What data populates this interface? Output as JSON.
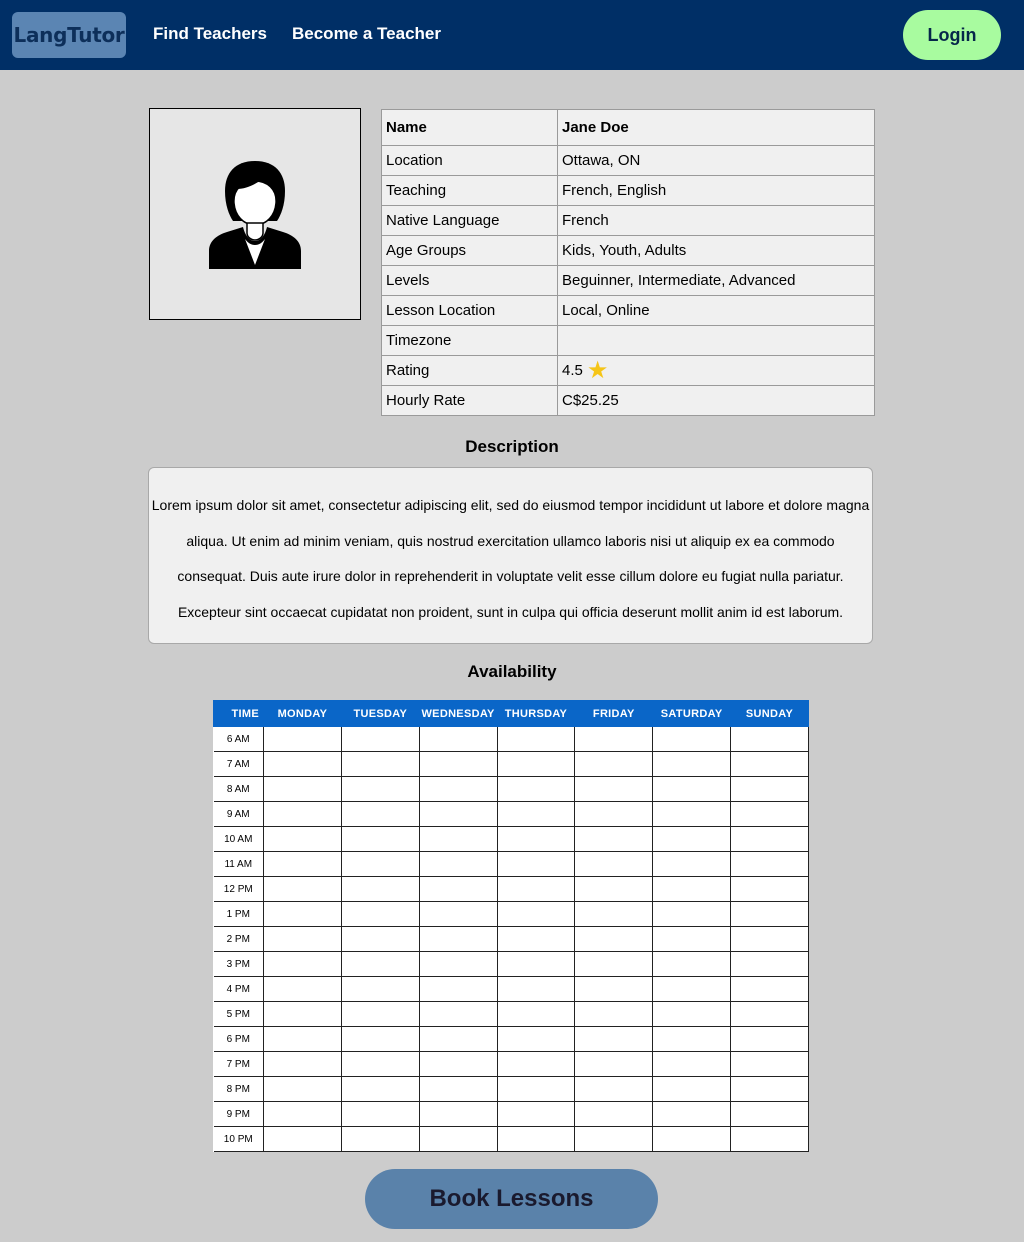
{
  "nav": {
    "logo": "LangTutor",
    "links": [
      "Find Teachers",
      "Become a Teacher"
    ],
    "login": "Login"
  },
  "profile": {
    "photo_icon": "person-avatar-icon",
    "rows": [
      {
        "label": "Name",
        "value": "Jane Doe"
      },
      {
        "label": "Location",
        "value": "Ottawa, ON"
      },
      {
        "label": "Teaching",
        "value": "French, English"
      },
      {
        "label": "Native Language",
        "value": "French"
      },
      {
        "label": "Age Groups",
        "value": "Kids, Youth, Adults"
      },
      {
        "label": "Levels",
        "value": "Beguinner, Intermediate, Advanced"
      },
      {
        "label": "Lesson Location",
        "value": "Local, Online"
      },
      {
        "label": "Timezone",
        "value": ""
      },
      {
        "label": "Rating",
        "value": "4.5"
      },
      {
        "label": "Hourly Rate",
        "value": "C$25.25"
      }
    ],
    "rating_icon": "star-icon"
  },
  "description": {
    "title": "Description",
    "text": "Lorem ipsum dolor sit amet, consectetur adipiscing elit, sed do eiusmod tempor incididunt ut labore et dolore magna aliqua. Ut enim ad minim veniam, quis nostrud exercitation ullamco laboris nisi ut aliquip ex ea commodo consequat. Duis aute irure dolor in reprehenderit in voluptate velit esse cillum dolore eu fugiat nulla pariatur. Excepteur sint occaecat cupidatat non proident, sunt in culpa qui officia deserunt mollit anim id est laborum."
  },
  "availability": {
    "title": "Availability",
    "columns": [
      "TIME",
      "MONDAY",
      "TUESDAY",
      "WEDNESDAY",
      "THURSDAY",
      "FRIDAY",
      "SATURDAY",
      "SUNDAY"
    ],
    "times": [
      "6 AM",
      "7 AM",
      "8 AM",
      "9 AM",
      "10 AM",
      "11 AM",
      "12 PM",
      "1 PM",
      "2 PM",
      "3 PM",
      "4 PM",
      "5 PM",
      "6 PM",
      "7 PM",
      "8 PM",
      "9 PM",
      "10 PM"
    ]
  },
  "book_button": "Book Lessons",
  "colors": {
    "nav_bg": "#002f66",
    "logo_bg": "#5b85b3",
    "login_bg": "#a8fb9f",
    "page_bg": "#cccccc",
    "schedule_header": "#0a66c8",
    "book_bg": "#5a82aa",
    "star": "#f5c518"
  }
}
